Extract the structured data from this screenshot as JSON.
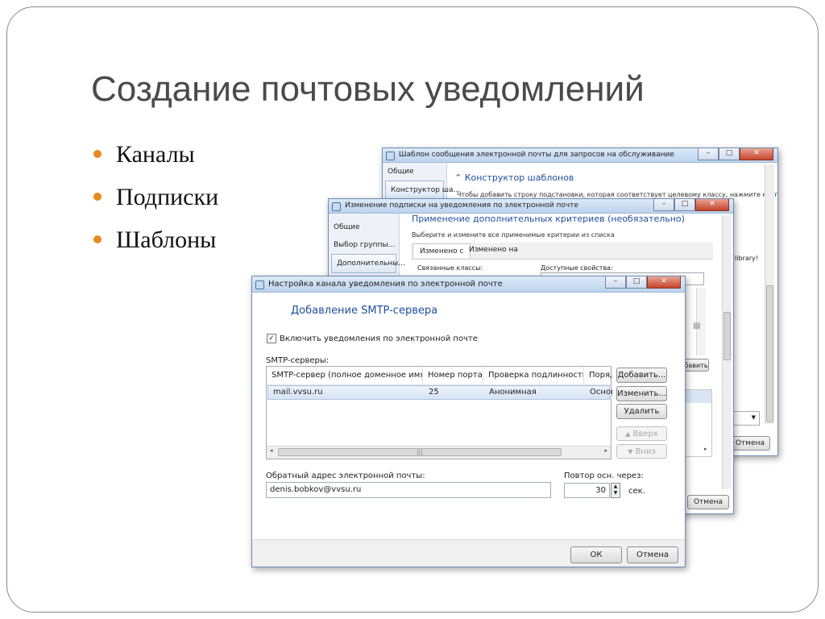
{
  "slide": {
    "title": "Создание почтовых уведомлений",
    "bullets": [
      "Каналы",
      "Подписки",
      "Шаблоны"
    ]
  },
  "colors": {
    "bullet": "#e88a1e",
    "title": "#4a4a4a",
    "link": "#1f4e9c"
  },
  "template_window": {
    "title": "Шаблон сообщения электронной почты для запросов на обслуживание",
    "nav": [
      "Общие",
      "Конструктор ша..."
    ],
    "section_header": "Конструктор шаблонов",
    "description": "Чтобы добавить строку подстановки, которая соответствует целевому классу, нажмите кнопку",
    "side_text": "library!",
    "cancel_label": "Отмена"
  },
  "subscription_window": {
    "title": "Изменение подписки на уведомления по электронной почте",
    "nav": [
      "Общие",
      "Выбор группы...",
      "Дополнительны..."
    ],
    "header": "Применение дополнительных критериев (необязательно)",
    "instruction": "Выберите и измените все применимые критерии из списка",
    "tabs": [
      "Изменено с",
      "Изменено на"
    ],
    "related_classes_label": "Связанные классы:",
    "available_props_label": "Доступные свойства:",
    "add_label": "бавить",
    "cancel_label": "Отмена"
  },
  "channel_window": {
    "title": "Настройка канала уведомления по электронной почте",
    "heading": "Добавление SMTP-сервера",
    "enable_label": "Включить уведомления по электронной почте",
    "enable_checked": true,
    "servers_label": "SMTP-серверы:",
    "columns": [
      "SMTP-сервер (полное доменное имя)",
      "Номер порта",
      "Проверка подлинности",
      "Поряд"
    ],
    "rows": [
      {
        "server": "mail.vvsu.ru",
        "port": "25",
        "auth": "Анонимная",
        "order": "Основ"
      }
    ],
    "buttons": {
      "add": "Добавить...",
      "edit": "Изменить...",
      "delete": "Удалить",
      "up": "Вверх",
      "down": "Вниз"
    },
    "return_label": "Обратный адрес электронной почты:",
    "return_value": "denis.bobkov@vvsu.ru",
    "retry_label": "Повтор осн. через:",
    "retry_value": "30",
    "retry_unit": "сек.",
    "ok_label": "ОК",
    "cancel_label": "Отмена"
  }
}
